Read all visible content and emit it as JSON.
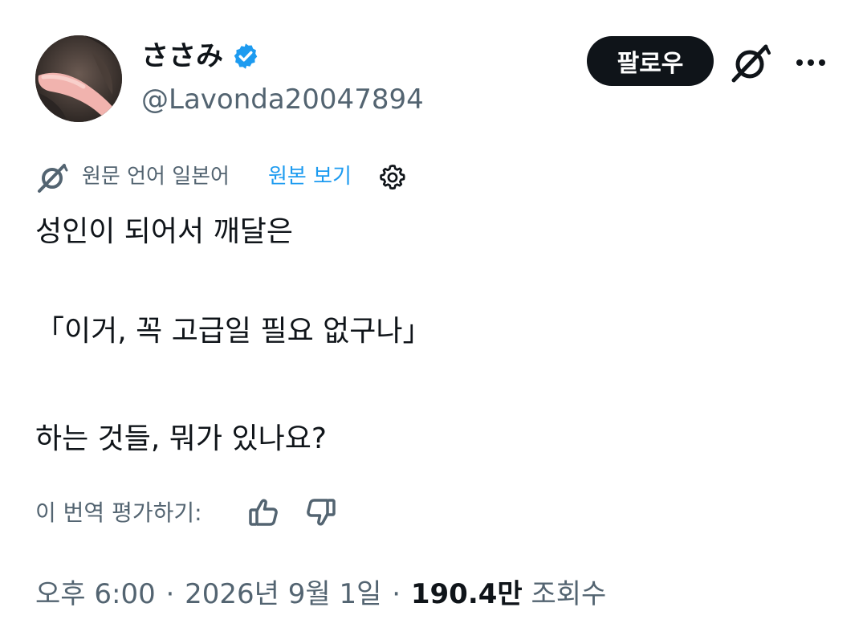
{
  "author": {
    "display_name": "ささみ",
    "handle": "@Lavonda20047894",
    "verified": true,
    "avatar_icon": "profile-photo"
  },
  "actions": {
    "follow_label": "팔로우",
    "grok_icon": "grok-icon",
    "more_icon": "more-horizontal-icon"
  },
  "translation": {
    "notice": "원문 언어 일본어",
    "show_original": "원본 보기",
    "rate_label": "이 번역 평가하기:"
  },
  "tweet": {
    "lines": [
      "성인이 되어서 깨달은",
      "",
      "「이거, 꼭 고급일 필요 없구나」",
      "",
      "하는 것들, 뭐가 있나요?"
    ]
  },
  "meta": {
    "time": "오후 6:00",
    "separator": "·",
    "date": "2026년 9월 1일",
    "views_count": "190.4만",
    "views_label": "조회수"
  },
  "colors": {
    "text_primary": "#0f1419",
    "text_secondary": "#536471",
    "link": "#1d9bf0",
    "follow_bg": "#0f1419",
    "verified_badge": "#1d9bf0"
  }
}
